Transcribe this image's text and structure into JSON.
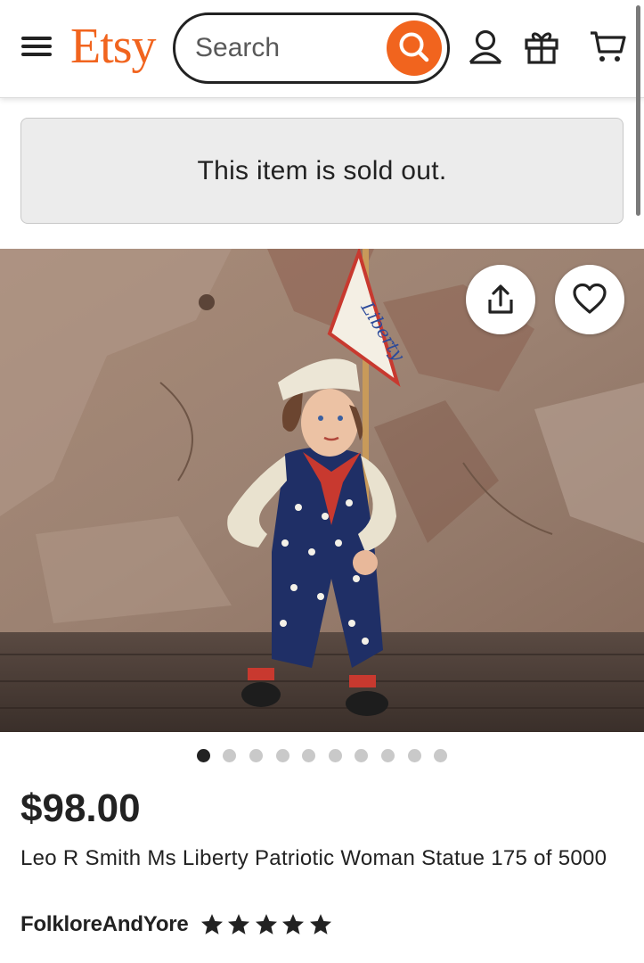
{
  "header": {
    "logo": "Etsy",
    "search_placeholder": "Search",
    "colors": {
      "brand": "#f1641e"
    }
  },
  "banner": {
    "sold_out_text": "This item is sold out."
  },
  "hero": {
    "flag_text": "Liberty",
    "image_count": 10,
    "active_image": 1
  },
  "listing": {
    "price": "$98.00",
    "title": "Leo R Smith Ms Liberty Patriotic Woman Statue 175 of 5000",
    "shop_name": "FolkloreAndYore",
    "rating_stars": 5
  },
  "icons": [
    "menu-icon",
    "search-icon",
    "account-icon",
    "gift-icon",
    "cart-icon",
    "share-icon",
    "heart-icon",
    "star-icon"
  ]
}
